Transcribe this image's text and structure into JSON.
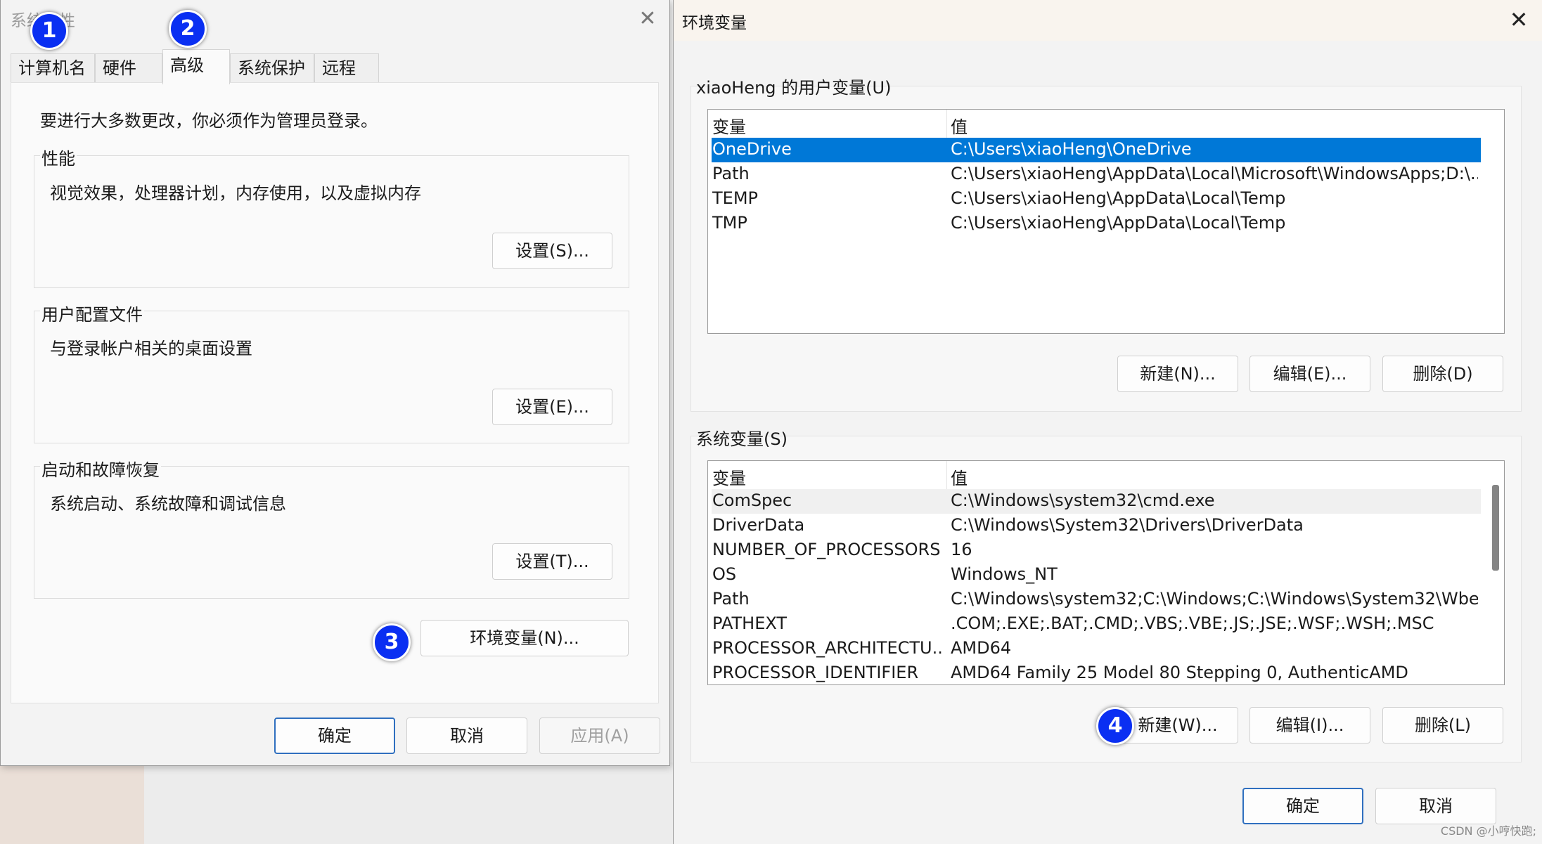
{
  "system_properties": {
    "title": "系统属性",
    "tabs": [
      "计算机名",
      "硬件",
      "高级",
      "系统保护",
      "远程"
    ],
    "active_tab": "高级",
    "notice": "要进行大多数更改，你必须作为管理员登录。",
    "performance": {
      "label": "性能",
      "description": "视觉效果，处理器计划，内存使用，以及虚拟内存",
      "button": "设置(S)..."
    },
    "user_profiles": {
      "label": "用户配置文件",
      "description": "与登录帐户相关的桌面设置",
      "button": "设置(E)..."
    },
    "startup_recovery": {
      "label": "启动和故障恢复",
      "description": "系统启动、系统故障和调试信息",
      "button": "设置(T)..."
    },
    "env_button": "环境变量(N)...",
    "ok": "确定",
    "cancel": "取消",
    "apply": "应用(A)"
  },
  "badges": [
    "1",
    "2",
    "3",
    "4"
  ],
  "environment_variables": {
    "title": "环境变量",
    "user_section": {
      "label": "xiaoHeng 的用户变量(U)",
      "col_name": "变量",
      "col_value": "值",
      "rows": [
        {
          "name": "OneDrive",
          "value": "C:\\Users\\xiaoHeng\\OneDrive"
        },
        {
          "name": "Path",
          "value": "C:\\Users\\xiaoHeng\\AppData\\Local\\Microsoft\\WindowsApps;D:\\..."
        },
        {
          "name": "TEMP",
          "value": "C:\\Users\\xiaoHeng\\AppData\\Local\\Temp"
        },
        {
          "name": "TMP",
          "value": "C:\\Users\\xiaoHeng\\AppData\\Local\\Temp"
        }
      ],
      "selected": "OneDrive",
      "new": "新建(N)...",
      "edit": "编辑(E)...",
      "delete": "删除(D)"
    },
    "system_section": {
      "label": "系统变量(S)",
      "col_name": "变量",
      "col_value": "值",
      "rows": [
        {
          "name": "ComSpec",
          "value": "C:\\Windows\\system32\\cmd.exe"
        },
        {
          "name": "DriverData",
          "value": "C:\\Windows\\System32\\Drivers\\DriverData"
        },
        {
          "name": "NUMBER_OF_PROCESSORS",
          "value": "16"
        },
        {
          "name": "OS",
          "value": "Windows_NT"
        },
        {
          "name": "Path",
          "value": "C:\\Windows\\system32;C:\\Windows;C:\\Windows\\System32\\Wbe..."
        },
        {
          "name": "PATHEXT",
          "value": ".COM;.EXE;.BAT;.CMD;.VBS;.VBE;.JS;.JSE;.WSF;.WSH;.MSC"
        },
        {
          "name": "PROCESSOR_ARCHITECTU...",
          "value": "AMD64"
        },
        {
          "name": "PROCESSOR_IDENTIFIER",
          "value": "AMD64 Family 25 Model 80 Stepping 0, AuthenticAMD"
        }
      ],
      "new": "新建(W)...",
      "edit": "编辑(I)...",
      "delete": "删除(L)"
    },
    "ok": "确定",
    "cancel": "取消"
  },
  "watermark": "CSDN @小哼快跑;"
}
